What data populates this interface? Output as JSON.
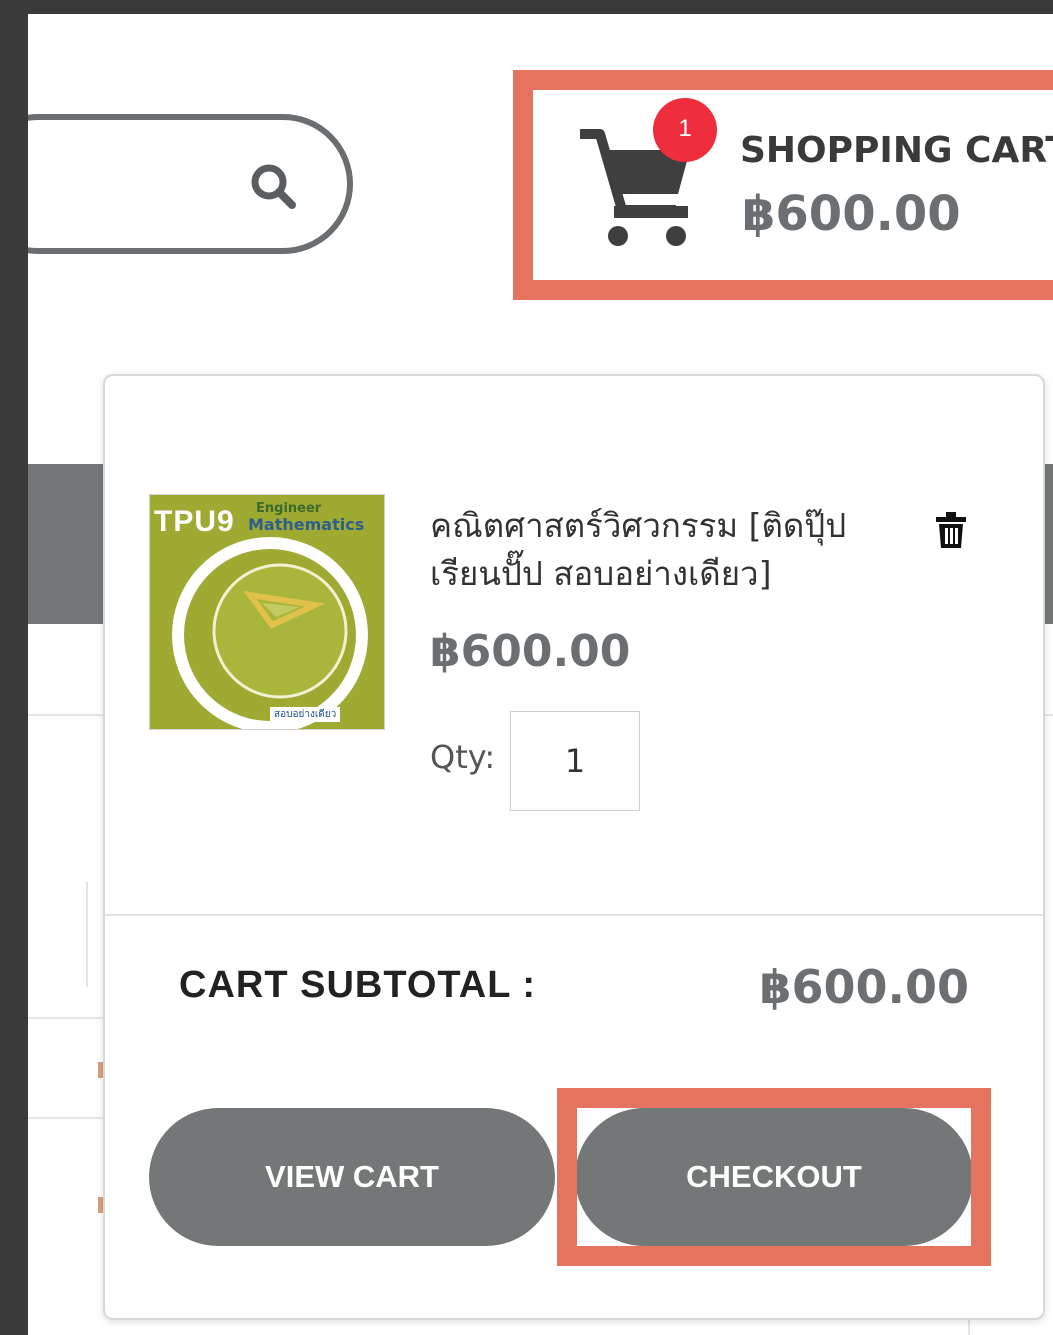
{
  "header": {
    "search_icon": "search-icon",
    "cart": {
      "icon": "cart-icon",
      "badge_count": "1",
      "title": "SHOPPING CART",
      "amount": "฿600.00"
    }
  },
  "mini_cart": {
    "item": {
      "name": "คณิตศาสตร์วิศวกรรม [ติดปุ๊ป เรียนปั๊ป สอบอย่างเดียว]",
      "price": "฿600.00",
      "qty_label": "Qty:",
      "qty_value": "1",
      "thumbnail": {
        "brand": "TPU9",
        "line1": "Engineer",
        "line2": "Mathematics",
        "footer": "สอบอย่างเดียว"
      },
      "remove_icon": "trash-icon"
    },
    "subtotal_label": "CART SUBTOTAL :",
    "subtotal_value": "฿600.00",
    "view_cart_label": "VIEW CART",
    "checkout_label": "CHECKOUT"
  },
  "colors": {
    "highlight": "#e4745f",
    "button": "#737778",
    "badge": "#ee2e3d",
    "price": "#6c6f71"
  }
}
